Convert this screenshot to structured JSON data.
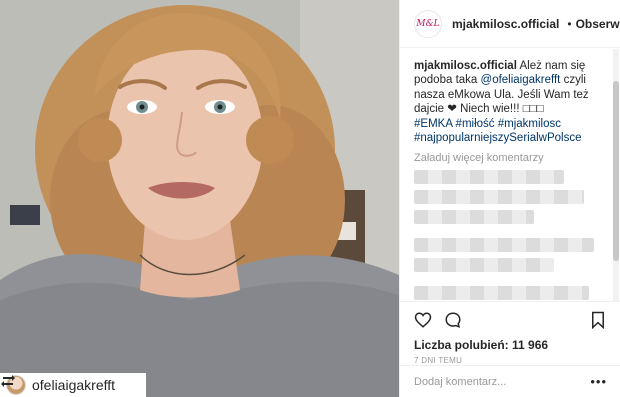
{
  "post": {
    "repost_user": "ofeliaigakrefft"
  },
  "header": {
    "logo_text": "M&L",
    "username": "mjakmilosc.official",
    "separator": "•",
    "follow_label": "Obserwowa"
  },
  "caption": {
    "username": "mjakmilosc.official",
    "text_1": "Ależ nam się podoba taka",
    "mention": "@ofeliaigakrefft",
    "text_2": "czyli nasza eMkowa Ula. Jeśli Wam też dajcie ❤ Niech wie!!! □□□",
    "hashtags_1": "#EMKA #miłość #mjakmilosc",
    "hashtags_2": "#najpopularniejszySerialwPolsce"
  },
  "comments": {
    "load_more": "Załaduj więcej komentarzy"
  },
  "actions": {
    "likes": "Liczba polubień: 11 966",
    "time": "7 DNI TEMU"
  },
  "add_comment": {
    "placeholder": "Dodaj komentarz...",
    "more": "•••"
  },
  "colors": {
    "hashtag": "#003569",
    "verified": "#3897f0",
    "muted": "#999999"
  },
  "icons": [
    "repost-icon",
    "verified-badge-icon",
    "heart-icon",
    "comment-icon",
    "bookmark-icon",
    "more-options-icon"
  ]
}
